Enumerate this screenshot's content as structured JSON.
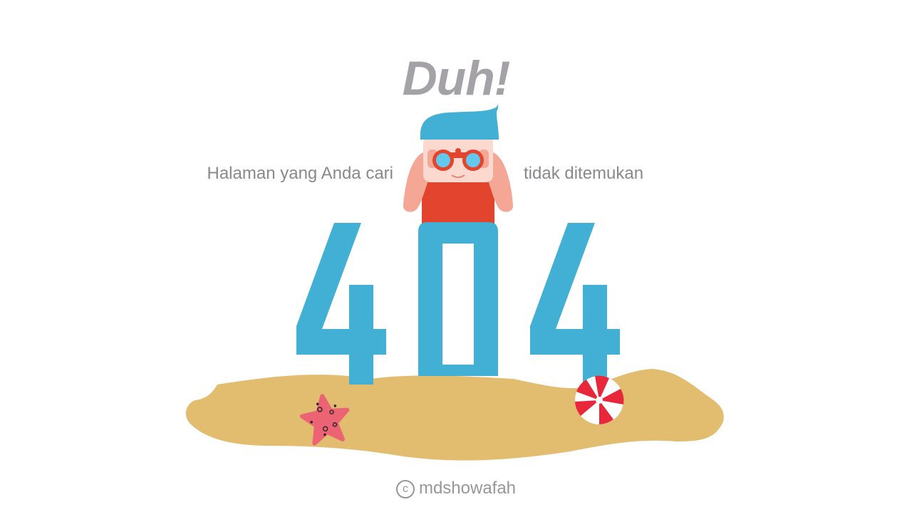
{
  "headline": "Duh!",
  "message": {
    "left": "Halaman yang Anda cari",
    "right": "tidak ditemukan"
  },
  "error_code": {
    "first_digit": "4",
    "middle_digit": "0",
    "last_digit": "4"
  },
  "credit": {
    "symbol": "c",
    "author": "mdshowafah"
  },
  "colors": {
    "background": "#ffffff",
    "headline": "#a4a2a6",
    "message": "#8a888c",
    "digits": "#42afd5",
    "sand": "#e2bd6f",
    "shirt": "#e2442e",
    "skin": "#f5a796",
    "hair": "#42afd5",
    "binoculars": "#e2442e",
    "lens": "#62c8ee",
    "starfish": "#ec6373",
    "ball_red": "#e8283a",
    "credit": "#98969a"
  },
  "icons": {
    "character": "lookout-with-binoculars-icon",
    "starfish": "starfish-icon",
    "ball": "beach-ball-icon",
    "copyright": "copyright-icon"
  }
}
